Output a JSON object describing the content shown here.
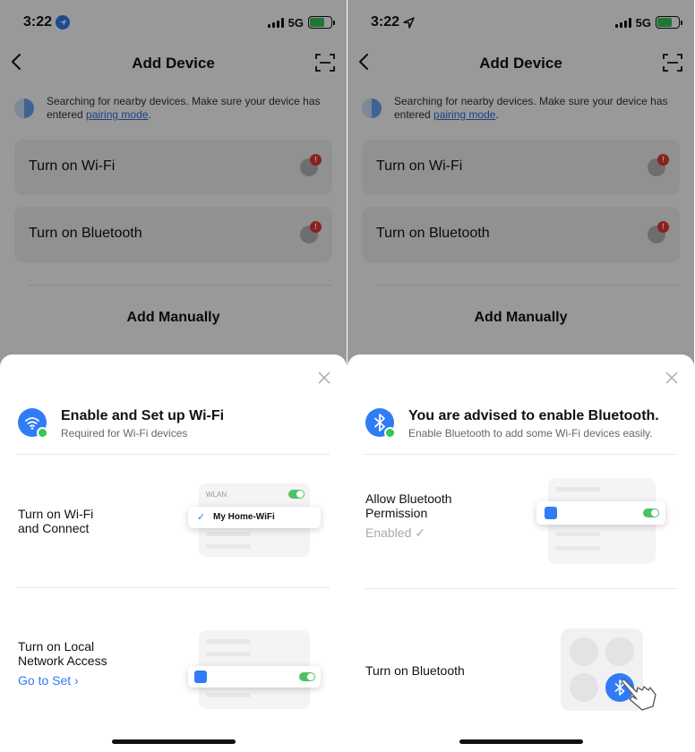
{
  "screens": [
    {
      "status": {
        "time": "3:22",
        "network": "5G"
      },
      "nav": {
        "title": "Add Device"
      },
      "search": {
        "text": "Searching for nearby devices. Make sure your device has entered ",
        "link": "pairing mode",
        "end": "."
      },
      "cards": [
        {
          "label": "Turn on Wi-Fi"
        },
        {
          "label": "Turn on Bluetooth"
        }
      ],
      "add_manually": "Add Manually",
      "sheet": {
        "title": "Enable and Set up Wi-Fi",
        "subtitle": "Required for Wi-Fi devices",
        "step1": {
          "line1": "Turn on Wi-Fi",
          "line2": "and Connect",
          "mock_header": "WLAN",
          "mock_network": "My Home-WiFi"
        },
        "step2": {
          "line1": "Turn on Local",
          "line2": "Network Access",
          "link": "Go to Set"
        }
      }
    },
    {
      "status": {
        "time": "3:22",
        "network": "5G"
      },
      "nav": {
        "title": "Add Device"
      },
      "search": {
        "text": "Searching for nearby devices. Make sure your device has entered ",
        "link": "pairing mode",
        "end": "."
      },
      "cards": [
        {
          "label": "Turn on Wi-Fi"
        },
        {
          "label": "Turn on Bluetooth"
        }
      ],
      "add_manually": "Add Manually",
      "sheet": {
        "title": "You are advised to enable Bluetooth.",
        "subtitle": "Enable Bluetooth to add some Wi-Fi devices easily.",
        "step1": {
          "line1": "Allow Bluetooth",
          "line2": "Permission",
          "status": "Enabled ✓"
        },
        "step2": {
          "line1": "Turn on Bluetooth"
        }
      }
    }
  ],
  "colors": {
    "accent": "#2f7cf6",
    "toggle_on": "#4cc264",
    "alert": "#e53935"
  },
  "icons": [
    "location-arrow-icon",
    "back-chevron-icon",
    "scan-icon",
    "wifi-icon",
    "bluetooth-icon",
    "close-icon",
    "alert-icon",
    "globe-icon",
    "airplane-icon",
    "antenna-icon",
    "hand-pointer-icon"
  ]
}
